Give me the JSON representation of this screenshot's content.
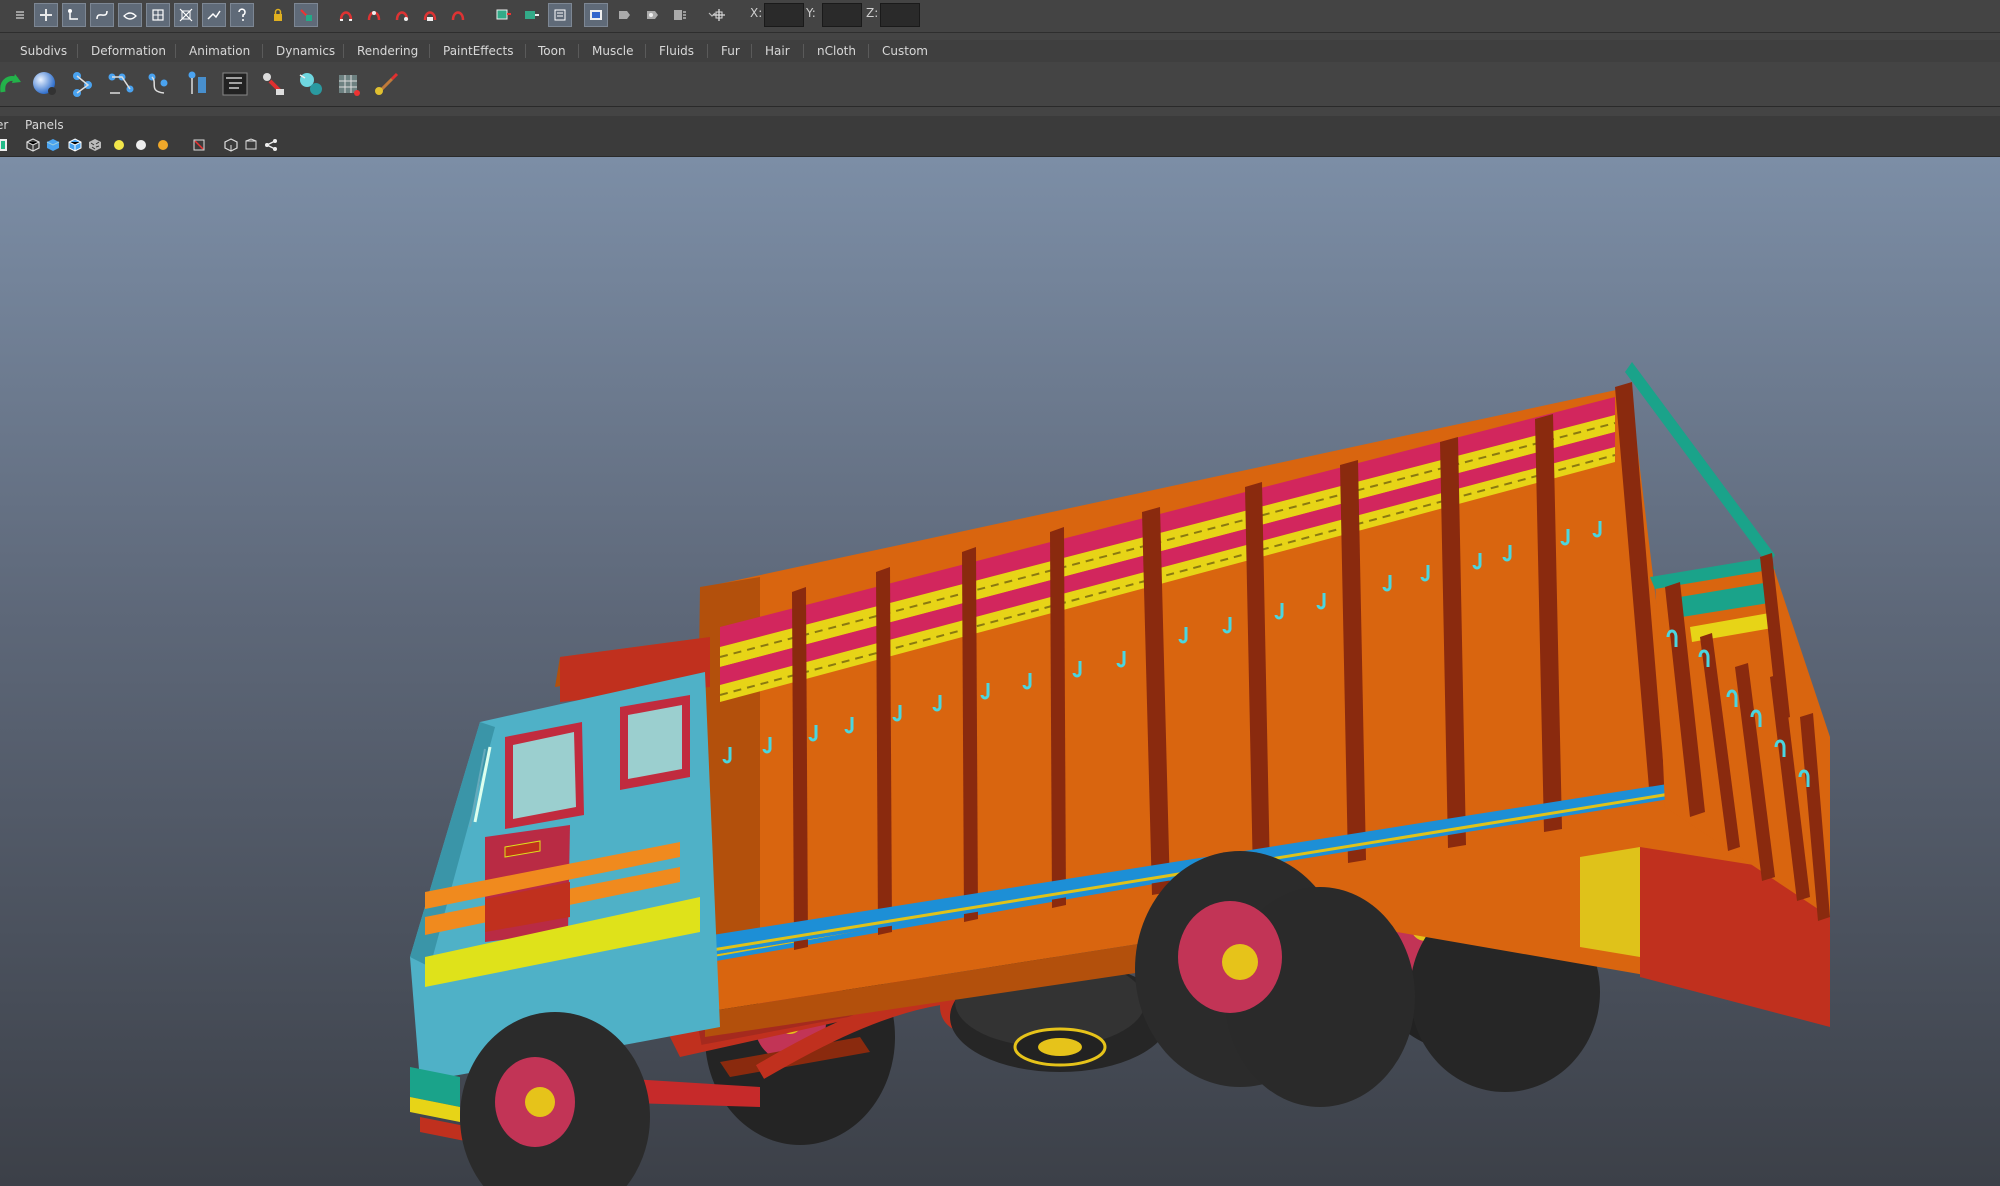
{
  "status_line": {
    "coords": {
      "x_label": "X:",
      "y_label": "Y:",
      "z_label": "Z:",
      "x_value": "",
      "y_value": "",
      "z_value": ""
    }
  },
  "shelf_tabs": [
    {
      "label": "Subdivs"
    },
    {
      "label": "Deformation"
    },
    {
      "label": "Animation"
    },
    {
      "label": "Dynamics"
    },
    {
      "label": "Rendering"
    },
    {
      "label": "PaintEffects"
    },
    {
      "label": "Toon"
    },
    {
      "label": "Muscle"
    },
    {
      "label": "Fluids"
    },
    {
      "label": "Fur"
    },
    {
      "label": "Hair"
    },
    {
      "label": "nCloth"
    },
    {
      "label": "Custom"
    }
  ],
  "panel_menu": {
    "partial_item": "er",
    "panels": "Panels"
  },
  "colors": {
    "cab": "#4fb1c7",
    "cargo_body": "#d9650f",
    "posts": "#8a2a0e",
    "rail_top": "#d2265d",
    "rail_yellow": "#e7d417",
    "trim_blue": "#1d8fd6",
    "tire": "#2b2b2b",
    "rim": "#c23456",
    "hub": "#e6c31a",
    "window_glass": "#9bcfcf",
    "cab_stripe_yellow": "#dfe21a",
    "cab_stripe_orange": "#f08a1e",
    "door_red": "#b92b44",
    "teal_rail": "#1aa38a"
  }
}
